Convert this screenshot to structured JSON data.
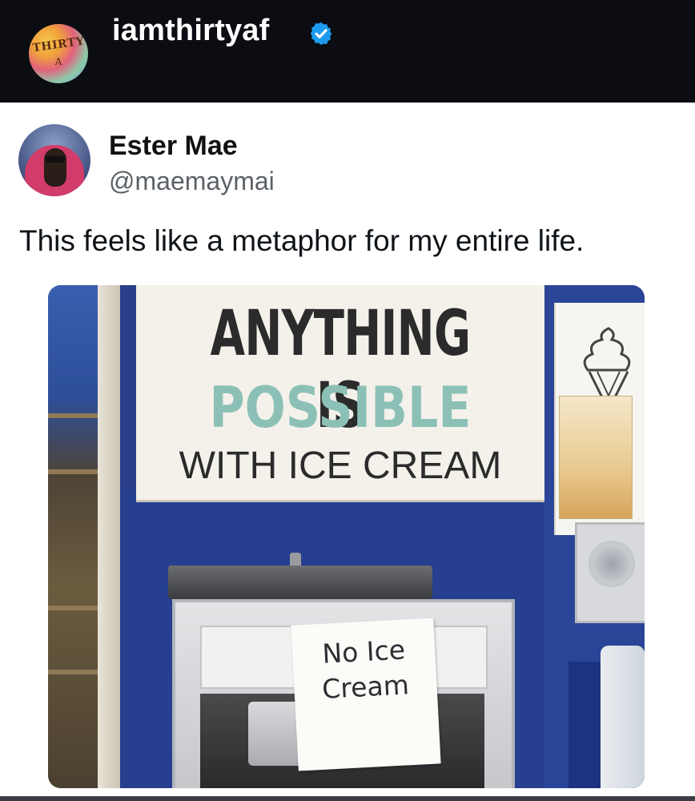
{
  "header": {
    "account_name": "iamthirtyaf",
    "avatar_text": "THIRTY",
    "avatar_subtext": "A",
    "verified": true,
    "verified_color": "#1d9bf0",
    "background_color": "#0b0d12"
  },
  "tweet": {
    "display_name": "Ester Mae",
    "handle": "@maemaymai",
    "text": "This feels like a metaphor for my entire life.",
    "photo": {
      "sign_line_1": "ANYTHING IS",
      "sign_line_2": "POSSIBLE",
      "sign_line_3": "WITH ICE CREAM",
      "paper_sign_line_1": "No Ice",
      "paper_sign_line_2": "Cream"
    }
  },
  "colors": {
    "sign_accent": "#8cc0b6",
    "booth_blue": "#263f8f"
  }
}
